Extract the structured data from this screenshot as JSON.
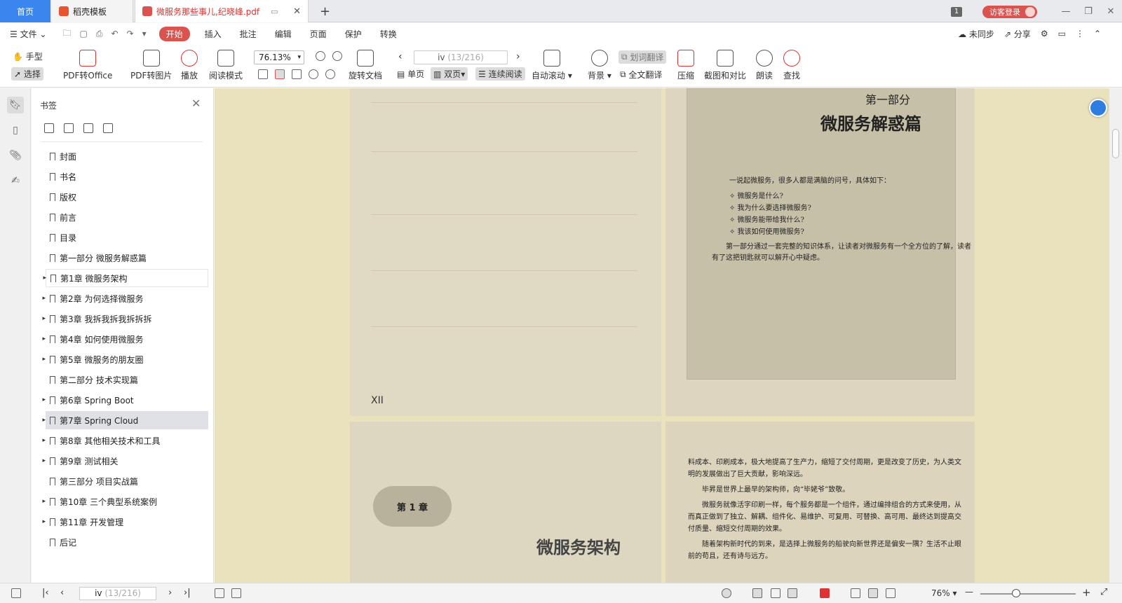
{
  "tabs": {
    "home": "首页",
    "template": "稻壳模板",
    "document": "微服务那些事儿,纪晓峰.pdf"
  },
  "window": {
    "badge": "1",
    "login": "访客登录",
    "min": "—",
    "restore": "❐",
    "close": "✕"
  },
  "menu": {
    "file": "文件",
    "items": [
      "开始",
      "插入",
      "批注",
      "编辑",
      "页面",
      "保护",
      "转换"
    ],
    "unsync": "未同步",
    "share": "分享"
  },
  "toolbar": {
    "hand": "手型",
    "select": "选择",
    "pdf_office": "PDF转Office",
    "pdf_image": "PDF转图片",
    "play": "播放",
    "read_mode": "阅读模式",
    "zoom": "76.13%",
    "rotate": "旋转文档",
    "page_current": "iv",
    "page_total": "(13/216)",
    "single": "单页",
    "double": "双页",
    "continuous": "连续阅读",
    "auto_scroll": "自动滚动",
    "background": "背景",
    "word_translate": "划词翻译",
    "full_translate": "全文翻译",
    "compress": "压缩",
    "screenshot": "截图和对比",
    "read_aloud": "朗读",
    "find": "查找"
  },
  "sidebar": {
    "title": "书签",
    "items": [
      {
        "label": "封面",
        "arrow": false
      },
      {
        "label": "书名",
        "arrow": false
      },
      {
        "label": "版权",
        "arrow": false
      },
      {
        "label": "前言",
        "arrow": false
      },
      {
        "label": "目录",
        "arrow": false
      },
      {
        "label": "第一部分 微服务解惑篇",
        "arrow": false
      },
      {
        "label": "第1章 微服务架构",
        "arrow": true
      },
      {
        "label": "第2章 为何选择微服务",
        "arrow": true
      },
      {
        "label": "第3章 我拆我拆我拆拆拆",
        "arrow": true
      },
      {
        "label": "第4章 如何使用微服务",
        "arrow": true
      },
      {
        "label": "第5章 微服务的朋友圈",
        "arrow": true
      },
      {
        "label": "第二部分 技术实现篇",
        "arrow": false
      },
      {
        "label": "第6章 Spring Boot",
        "arrow": true
      },
      {
        "label": "第7章 Spring Cloud",
        "arrow": true
      },
      {
        "label": "第8章 其他相关技术和工具",
        "arrow": true
      },
      {
        "label": "第9章 测试相关",
        "arrow": true
      },
      {
        "label": "第三部分 项目实战篇",
        "arrow": false
      },
      {
        "label": "第10章 三个典型系统案例",
        "arrow": true
      },
      {
        "label": "第11章 开发管理",
        "arrow": true
      },
      {
        "label": "后记",
        "arrow": false
      }
    ]
  },
  "document": {
    "left_page_number": "XII",
    "part_label": "第一部分",
    "part_title": "微服务解惑篇",
    "intro": "一说起微服务，很多人都是满脑的问号，具体如下：",
    "questions": [
      "✧  微服务是什么?",
      "✧  我为什么要选择微服务?",
      "✧  微服务能带给我什么?",
      "✧  我该如何使用微服务?"
    ],
    "part_para": "第一部分通过一套完整的知识体系，让读者对微服务有一个全方位的了解，读者有了这把钥匙就可以解开心中疑虑。",
    "chapter_label": "第 1 章",
    "chapter_title": "微服务架构",
    "body": [
      "料成本、印刷成本，极大地提高了生产力，缩短了交付周期，更是改变了历史，为人类文明的发展做出了巨大贡献，影响深远。",
      "毕昇是世界上最早的架构师，向“毕姥爷”致敬。",
      "微服务就像活字印刷一样，每个服务都是一个组件，通过编排组合的方式来使用，从而真正做到了独立、解耦、组件化、易维护、可复用、可替换、高可用、最终达到提高交付质量、缩短交付周期的效果。",
      "随着架构新时代的到来，是选择上微服务的船驶向新世界还是偏安一隅？生活不止眼前的苟且，还有诗与远方。"
    ]
  },
  "statusbar": {
    "page_current": "iv",
    "page_total": "(13/216)",
    "zoom": "76%",
    "minus": "—",
    "plus": "+"
  },
  "colors": {
    "accent": "#3a86ee",
    "brand_red": "#d9534f",
    "doc_bg": "#eae1bd"
  }
}
